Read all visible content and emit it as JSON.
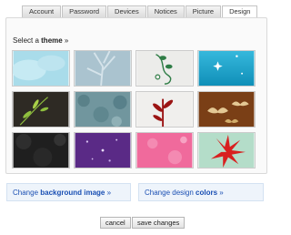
{
  "tabs": [
    {
      "label": "Account"
    },
    {
      "label": "Password"
    },
    {
      "label": "Devices"
    },
    {
      "label": "Notices"
    },
    {
      "label": "Picture"
    },
    {
      "label": "Design",
      "active": true
    }
  ],
  "theme_section": {
    "prefix": "Select a ",
    "bold": "theme",
    "suffix": " »"
  },
  "themes": [
    {
      "bg": "#a9dcea",
      "icon": "sky-clouds-icon"
    },
    {
      "bg": "#aac3cf",
      "icon": "tree-branches-icon"
    },
    {
      "bg": "#ececea",
      "icon": "vine-swirl-icon"
    },
    {
      "bg": "#1aa2c9",
      "icon": "sparkles-icon"
    },
    {
      "bg": "#2e2a24",
      "icon": "green-leaves-icon"
    },
    {
      "bg": "#71969e",
      "icon": "foliage-pattern-icon"
    },
    {
      "bg": "#f0efed",
      "icon": "red-plant-icon"
    },
    {
      "bg": "#7a3f16",
      "icon": "birds-icon"
    },
    {
      "bg": "#1f1f1f",
      "icon": "dark-leaves-icon"
    },
    {
      "bg": "#5a2a86",
      "icon": "purple-stars-icon"
    },
    {
      "bg": "#f06a9c",
      "icon": "pink-flowers-icon"
    },
    {
      "bg": "#b4ddc9",
      "icon": "red-flower-icon"
    }
  ],
  "links": {
    "background": {
      "prefix": "Change ",
      "bold": "background image",
      "suffix": " »"
    },
    "colors": {
      "prefix": "Change design ",
      "bold": "colors",
      "suffix": " »"
    }
  },
  "buttons": {
    "cancel": "cancel",
    "save": "save changes"
  }
}
